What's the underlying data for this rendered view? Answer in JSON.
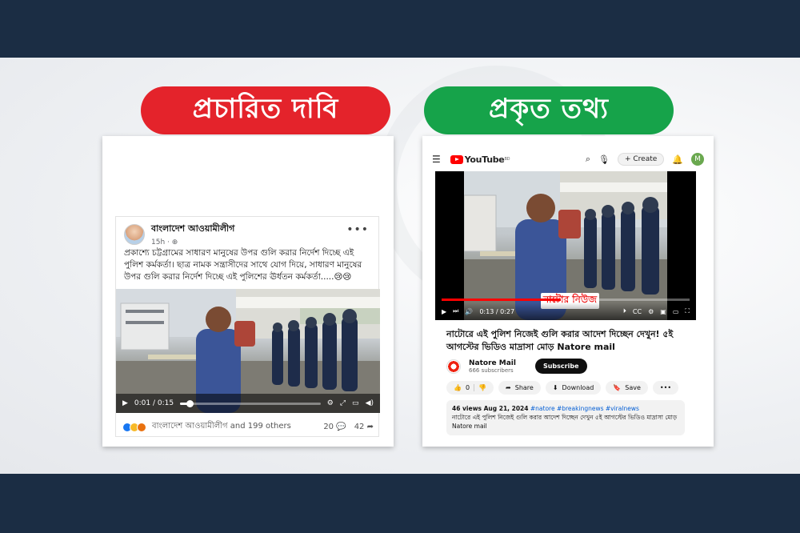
{
  "banners": {
    "claim": "প্রচারিত দাবি",
    "fact": "প্রকৃত তথ্য",
    "claim_color": "#e4232b",
    "fact_color": "#16a34a"
  },
  "facebook_post": {
    "page_name": "বাংলাদেশ আওয়ামীলীগ",
    "time": "15h · ",
    "more_icon": "more-icon",
    "text": "প্রকাশ্যে চট্টগ্রামের সাধারণ মানুষের উপর গুলি করার নির্দেশ দিচ্ছে এই পুলিশ কর্মকর্তা। ছাত্র নামক সন্ত্রাসীদের সাথে যোগ দিয়ে, সাধারণ মানুষের উপর গুলি করার নির্দেশ দিচ্ছে এই পুলিশের ঊর্ধতন কর্মকর্তা.....😢😢",
    "video_time": "0:01 / 0:15",
    "video_progress": 0.067,
    "reactions_text": "বাংলাদেশ আওয়ামীলীগ and 199 others",
    "comments": "20",
    "shares": "42"
  },
  "youtube": {
    "logo_text": "YouTube",
    "logo_superscript": "BD",
    "create_label": "Create",
    "avatar_letter": "M",
    "video_time": "0:13 / 0:27",
    "video_progress": 0.48,
    "overlay_text": "নাটোর নিউজ",
    "title": "নাটোরে এই পুলিশ নিজেই গুলি করার আদেশ দিচ্ছেন দেখুন! ৫ই আগস্টের ভিডিও মাদ্রাসা মোড় Natore mail",
    "channel_name": "Natore Mail",
    "subscribers": "666 subscribers",
    "subscribe_label": "Subscribe",
    "likes": "0",
    "share_label": "Share",
    "download_label": "Download",
    "save_label": "Save",
    "views_date": "46 views  Aug 21, 2024",
    "tags": "#natore #breakingnews #viralnews",
    "description": "নাটোরে এই পুলিশ নিজেই গুলি করার আদেশ দিচ্ছেন দেখুন ৫ই আগস্টের ভিডিও মাদ্রাসা মোড় Natore mail"
  }
}
